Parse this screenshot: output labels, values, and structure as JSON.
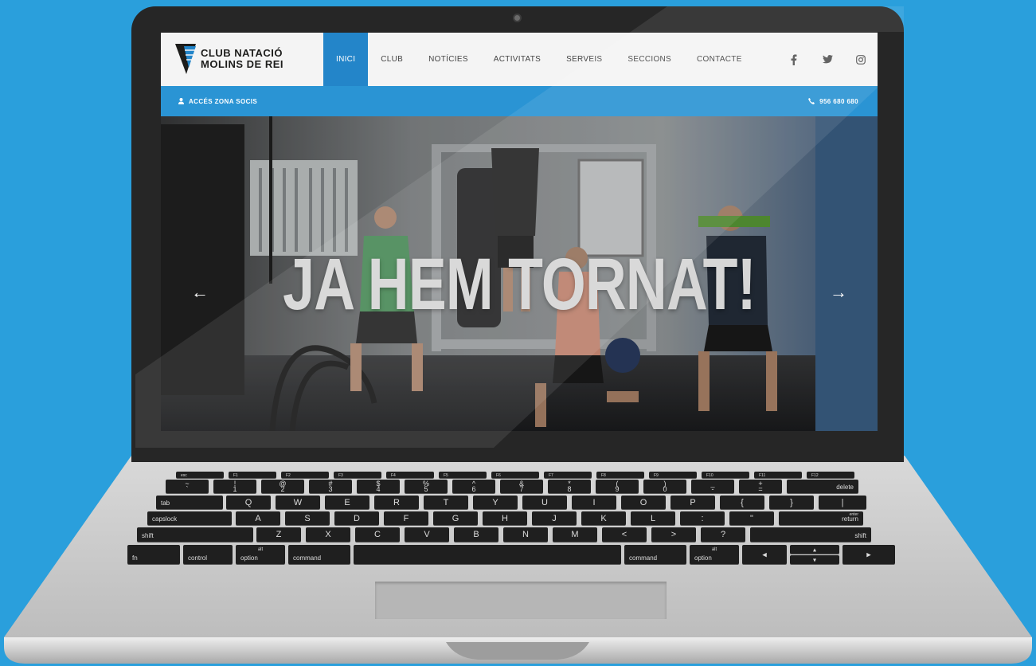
{
  "site": {
    "logo": {
      "line1": "CLUB NATACIÓ",
      "line2": "MOLINS DE REI"
    },
    "nav": [
      {
        "label": "INICI",
        "active": true
      },
      {
        "label": "CLUB"
      },
      {
        "label": "NOTÍCIES"
      },
      {
        "label": "ACTIVITATS"
      },
      {
        "label": "SERVEIS"
      },
      {
        "label": "SECCIONS"
      },
      {
        "label": "CONTACTE"
      }
    ],
    "social": [
      "facebook-icon",
      "twitter-icon",
      "instagram-icon"
    ],
    "info_bar": {
      "members_link": "ACCÉS ZONA SOCIS",
      "phone": "956 680 680"
    },
    "hero": {
      "title": "JA HEM TORNAT!",
      "prev": "←",
      "next": "→"
    },
    "colors": {
      "accent": "#2385c9",
      "bar": "#2a94d4",
      "background": "#2a9fdc"
    }
  },
  "keyboard": {
    "row0": [
      "esc",
      "F1",
      "F2",
      "F3",
      "F4",
      "F5",
      "F6",
      "F7",
      "F8",
      "F9",
      "F10",
      "F11",
      "F12"
    ],
    "row1": [
      [
        "~",
        "`"
      ],
      [
        "!",
        "1"
      ],
      [
        "@",
        "2"
      ],
      [
        "#",
        "3"
      ],
      [
        "$",
        "4"
      ],
      [
        "%",
        "5"
      ],
      [
        "^",
        "6"
      ],
      [
        "&",
        "7"
      ],
      [
        "*",
        "8"
      ],
      [
        "(",
        "9"
      ],
      [
        ")",
        "0"
      ],
      [
        "_",
        "-"
      ],
      [
        "+",
        "="
      ],
      [
        "",
        "delete"
      ]
    ],
    "row2": [
      "tab",
      "Q",
      "W",
      "E",
      "R",
      "T",
      "Y",
      "U",
      "I",
      "O",
      "P",
      "{",
      "}",
      "|"
    ],
    "row3": [
      "capslock",
      "A",
      "S",
      "D",
      "F",
      "G",
      "H",
      "J",
      "K",
      "L",
      ":",
      "\"",
      "return"
    ],
    "row3_extra": {
      "enter": "enter"
    },
    "row4": [
      "shift",
      "Z",
      "X",
      "C",
      "V",
      "B",
      "N",
      "M",
      "<",
      ">",
      "?",
      "shift"
    ],
    "row5": [
      "fn",
      "control",
      "option",
      "command",
      "",
      "command",
      "option"
    ],
    "alt_label": "alt"
  }
}
